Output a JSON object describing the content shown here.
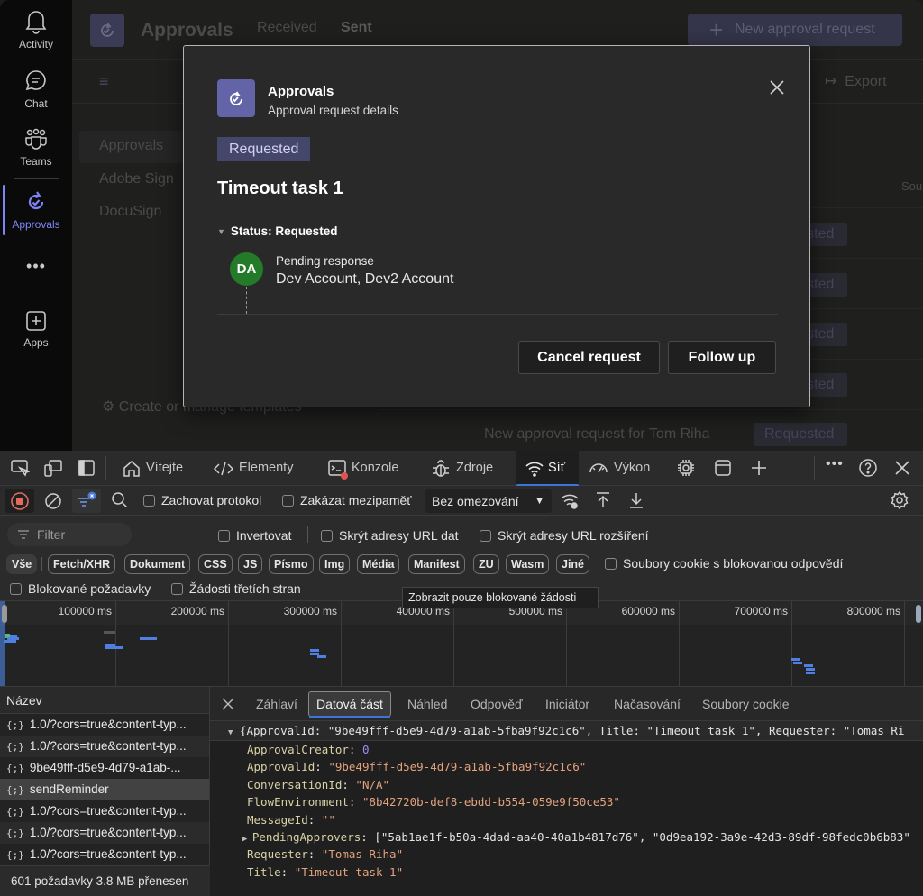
{
  "rail": {
    "items": [
      {
        "label": "Activity",
        "icon": "bell-icon"
      },
      {
        "label": "Chat",
        "icon": "chat-icon"
      },
      {
        "label": "Teams",
        "icon": "teams-icon"
      },
      {
        "label": "Approvals",
        "icon": "approvals-icon",
        "active": true
      },
      {
        "label": "",
        "icon": "more-icon"
      },
      {
        "label": "Apps",
        "icon": "apps-icon"
      }
    ]
  },
  "background": {
    "app_title": "Approvals",
    "tabs": [
      "Received",
      "Sent"
    ],
    "new_request_label": "New approval request",
    "export_label": "Export",
    "left_nav": [
      "Approvals",
      "Adobe Sign",
      "DocuSign"
    ],
    "templates_link": "Create or manage templates",
    "source_header": "Sou",
    "status_pills": [
      "Requested",
      "Requested",
      "Requested",
      "Requested",
      "Requested"
    ],
    "last_row_title": "New approval request for Tom Riha"
  },
  "modal": {
    "app_name": "Approvals",
    "subtitle": "Approval request details",
    "status_badge": "Requested",
    "task_title": "Timeout task 1",
    "status_header": "Status: Requested",
    "avatar_initials": "DA",
    "avatar_color": "#237b2a",
    "pending_label": "Pending response",
    "approvers": "Dev Account, Dev2 Account",
    "cancel_label": "Cancel request",
    "followup_label": "Follow up"
  },
  "devtools": {
    "tabs": [
      {
        "label": "Vítejte",
        "icon": "home-icon"
      },
      {
        "label": "Elementy",
        "icon": "code-icon"
      },
      {
        "label": "Konzole",
        "icon": "console-icon"
      },
      {
        "label": "Zdroje",
        "icon": "bug-icon"
      },
      {
        "label": "Síť",
        "icon": "wifi-icon",
        "selected": true
      },
      {
        "label": "Výkon",
        "icon": "performance-icon"
      }
    ],
    "toolbar": {
      "preserve_log": "Zachovat protokol",
      "disable_cache": "Zakázat mezipaměť",
      "throttling": "Bez omezování"
    },
    "filter": {
      "placeholder": "Filter",
      "invert": "Invertovat",
      "hide_data_urls": "Skrýt adresy URL dat",
      "hide_extension_urls": "Skrýt adresy URL rozšíření",
      "types": [
        "Vše",
        "Fetch/XHR",
        "Dokument",
        "CSS",
        "JS",
        "Písmo",
        "Img",
        "Média",
        "Manifest",
        "ZU",
        "Wasm",
        "Jiné"
      ],
      "blocked_cookies": "Soubory cookie s blokovanou odpovědí",
      "blocked_requests": "Blokované požadavky",
      "third_party": "Žádosti třetích stran",
      "tooltip": "Zobrazit pouze blokované žádosti"
    },
    "overview": {
      "ticks": [
        "100000 ms",
        "200000 ms",
        "300000 ms",
        "400000 ms",
        "500000 ms",
        "600000 ms",
        "700000 ms",
        "800000 ms"
      ]
    },
    "requests": {
      "header": "Název",
      "rows": [
        "1.0/?cors=true&content-typ...",
        "1.0/?cors=true&content-typ...",
        "9be49fff-d5e9-4d79-a1ab-...",
        "sendReminder",
        "1.0/?cors=true&content-typ...",
        "1.0/?cors=true&content-typ...",
        "1.0/?cors=true&content-typ..."
      ],
      "selected_index": 3,
      "footer": "601 požadavky  3.8 MB přenesen"
    },
    "detail_tabs": [
      "Záhlaví",
      "Datová část",
      "Náhled",
      "Odpověď",
      "Iniciátor",
      "Načasování",
      "Soubory cookie"
    ],
    "detail_selected": "Datová část",
    "payload": {
      "summary": "{ApprovalId: \"9be49fff-d5e9-4d79-a1ab-5fba9f92c1c6\", Title: \"Timeout task 1\", Requester: \"Tomas Ri",
      "fields": [
        {
          "key": "ApprovalCreator",
          "value": "0",
          "type": "number"
        },
        {
          "key": "ApprovalId",
          "value": "\"9be49fff-d5e9-4d79-a1ab-5fba9f92c1c6\"",
          "type": "string"
        },
        {
          "key": "ConversationId",
          "value": "\"N/A\"",
          "type": "string"
        },
        {
          "key": "FlowEnvironment",
          "value": "\"8b42720b-def8-ebdd-b554-059e9f50ce53\"",
          "type": "string"
        },
        {
          "key": "MessageId",
          "value": "\"\"",
          "type": "string"
        },
        {
          "key": "PendingApprovers",
          "value": "[\"5ab1ae1f-b50a-4dad-aa40-40a1b4817d76\", \"0d9ea192-3a9e-42d3-89df-98fedc0b6b83\"",
          "type": "array"
        },
        {
          "key": "Requester",
          "value": "\"Tomas Riha\"",
          "type": "string"
        },
        {
          "key": "Title",
          "value": "\"Timeout task 1\"",
          "type": "string"
        }
      ]
    }
  }
}
